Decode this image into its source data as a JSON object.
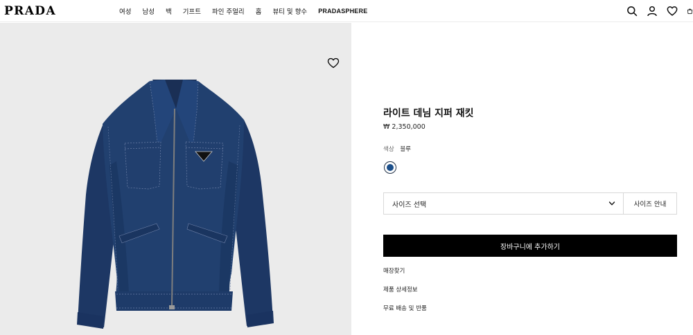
{
  "header": {
    "logo": "PRADA",
    "nav": [
      "여성",
      "남성",
      "백",
      "기프트",
      "파인 주얼리",
      "홈",
      "뷰티 및 향수",
      "PRADASPHERE"
    ],
    "icons": [
      "search-icon",
      "account-icon",
      "wishlist-icon",
      "bag-icon"
    ]
  },
  "product": {
    "title": "라이트 데님 지퍼 재킷",
    "price": "₩ 2,350,000",
    "color_label": "색상",
    "color_value": "블루",
    "swatch_color": "#1c4f8a",
    "size_placeholder": "사이즈 선택",
    "size_guide": "사이즈 안내",
    "add_to_cart": "장바구니에 추가하기",
    "links": [
      "매장찾기",
      "제품 상세정보",
      "무료 배송 및 반품"
    ]
  },
  "colors": {
    "image_background": "#ebebeb",
    "denim": "#1e3a6b",
    "button": "#000000"
  }
}
